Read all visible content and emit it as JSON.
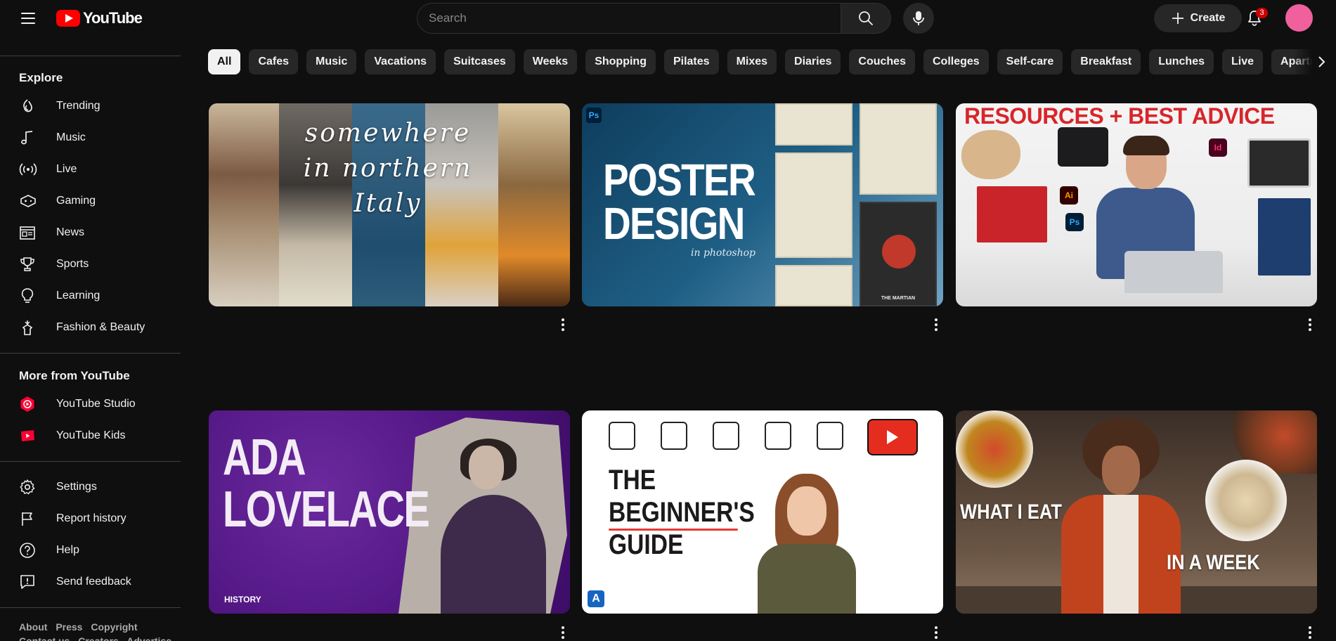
{
  "header": {
    "logo_text": "YouTube",
    "search_placeholder": "Search",
    "create_label": "Create",
    "notification_count": "3"
  },
  "sidebar": {
    "explore_heading": "Explore",
    "explore_items": [
      {
        "label": "Trending",
        "icon": "trending-icon"
      },
      {
        "label": "Music",
        "icon": "music-icon"
      },
      {
        "label": "Live",
        "icon": "live-icon"
      },
      {
        "label": "Gaming",
        "icon": "gaming-icon"
      },
      {
        "label": "News",
        "icon": "news-icon"
      },
      {
        "label": "Sports",
        "icon": "sports-icon"
      },
      {
        "label": "Learning",
        "icon": "learning-icon"
      },
      {
        "label": "Fashion & Beauty",
        "icon": "fashion-icon"
      }
    ],
    "more_heading": "More from YouTube",
    "more_items": [
      {
        "label": "YouTube Studio",
        "icon": "youtube-studio-icon"
      },
      {
        "label": "YouTube Kids",
        "icon": "youtube-kids-icon"
      }
    ],
    "settings_items": [
      {
        "label": "Settings",
        "icon": "gear-icon"
      },
      {
        "label": "Report history",
        "icon": "flag-icon"
      },
      {
        "label": "Help",
        "icon": "help-icon"
      },
      {
        "label": "Send feedback",
        "icon": "feedback-icon"
      }
    ],
    "footer_line1": [
      "About",
      "Press",
      "Copyright"
    ],
    "footer_line2": [
      "Contact us",
      "Creators",
      "Advertise"
    ]
  },
  "chips": [
    "All",
    "Cafes",
    "Music",
    "Vacations",
    "Suitcases",
    "Weeks",
    "Shopping",
    "Pilates",
    "Mixes",
    "Diaries",
    "Couches",
    "Colleges",
    "Self-care",
    "Breakfast",
    "Lunches",
    "Live",
    "Apartments"
  ],
  "videos": [
    {
      "thumb_text": "somewhere in northern Italy"
    },
    {
      "thumb_title": "POSTER DESIGN",
      "thumb_sub": "in photoshop",
      "badge": "Ps",
      "poster_caption": "THE MARTIAN"
    },
    {
      "thumb_title": "RESOURCES + BEST ADVICE",
      "badges": [
        "Id",
        "Ai",
        "Ps"
      ]
    },
    {
      "thumb_title": "ADA LOVELACE",
      "brand": "HISTORY"
    },
    {
      "thumb_title": "THE BEGINNER'S GUIDE",
      "logo": "A"
    },
    {
      "thumb_text_1": "WHAT I EAT",
      "thumb_text_2": "IN A WEEK"
    }
  ],
  "colors": {
    "background": "#0f0f0f",
    "chip": "#272727",
    "chip_active": "#f1f1f1",
    "brand_red": "#ff0000",
    "avatar": "#f0609c",
    "divider": "#3f3f3f"
  }
}
